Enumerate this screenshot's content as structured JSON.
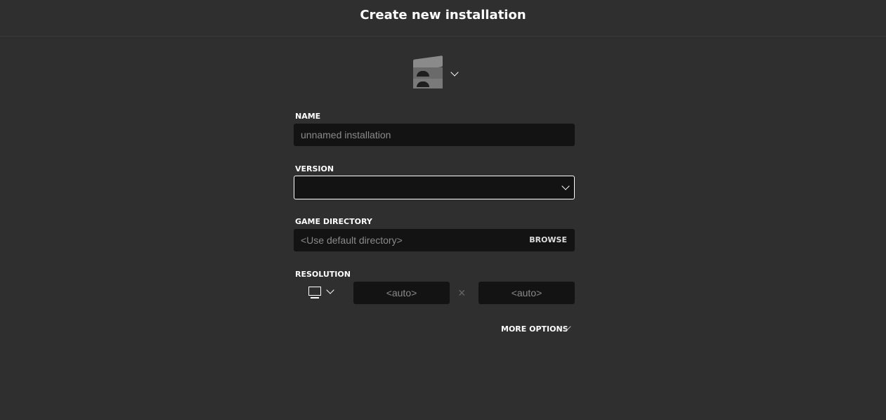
{
  "header": {
    "title": "Create new installation"
  },
  "icon": {
    "name": "furnace-icon"
  },
  "name": {
    "label": "NAME",
    "placeholder": "unnamed installation"
  },
  "version": {
    "label": "VERSION",
    "value": ""
  },
  "game_directory": {
    "label": "GAME DIRECTORY",
    "placeholder": "<Use default directory>",
    "browse": "BROWSE"
  },
  "resolution": {
    "label": "RESOLUTION",
    "width": "<auto>",
    "height": "<auto>",
    "separator": "×"
  },
  "more_options": "MORE OPTIONS"
}
